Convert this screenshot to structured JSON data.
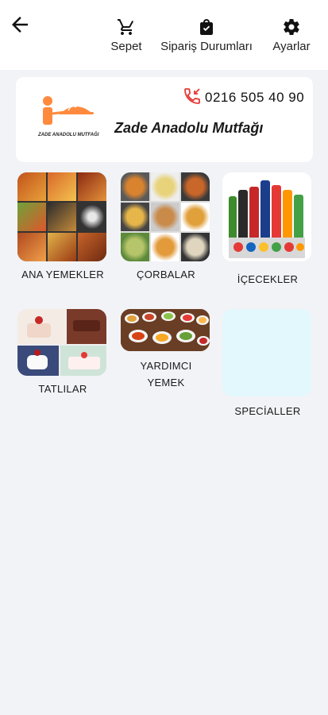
{
  "header": {
    "nav": [
      {
        "label": "Sepet",
        "icon": "cart-icon"
      },
      {
        "label": "Sipariş Durumları",
        "icon": "shopping-bag-icon"
      },
      {
        "label": "Ayarlar",
        "icon": "gear-icon"
      }
    ]
  },
  "restaurant": {
    "logo_text": "ZADE ANADOLU MUTFAĞI",
    "phone": "0216 505 40 90",
    "name": "Zade Anadolu Mutfağı"
  },
  "categories": [
    {
      "label": "ANA YEMEKLER"
    },
    {
      "label": "ÇORBALAR"
    },
    {
      "label": "İÇECEKLER"
    },
    {
      "label": "TATLILAR"
    },
    {
      "label": "YARDIMCI YEMEK"
    },
    {
      "label": "SPECİALLER"
    }
  ],
  "colors": {
    "accent": "#ff8a3d",
    "phone_red": "#e53935",
    "background": "#f2f3f7",
    "special_tile": "#e3f8fc"
  }
}
